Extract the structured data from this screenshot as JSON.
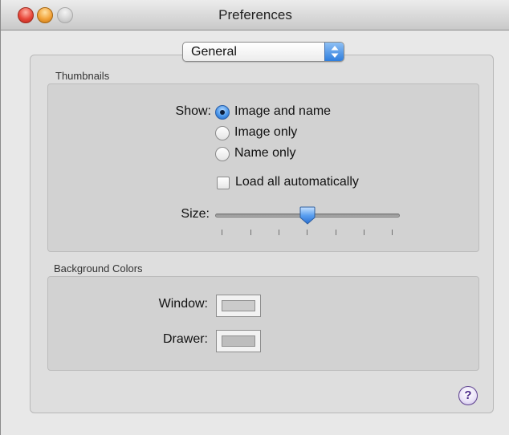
{
  "window": {
    "title": "Preferences"
  },
  "popup": {
    "selected": "General"
  },
  "thumbnails": {
    "section_label": "Thumbnails",
    "show_label": "Show:",
    "options": [
      "Image and name",
      "Image only",
      "Name only"
    ],
    "selected_option": "Image and name",
    "load_all_label": "Load all automatically",
    "load_all_checked": false,
    "size_label": "Size:",
    "size_value_fraction": 0.5
  },
  "background_colors": {
    "section_label": "Background Colors",
    "window_label": "Window:",
    "window_color": "#cbcbcb",
    "drawer_label": "Drawer:",
    "drawer_color": "#bdbdbd"
  },
  "help": {
    "glyph": "?"
  },
  "colors": {
    "accent_blue": "#3b86e3",
    "help_purple": "#4b2a8a"
  }
}
